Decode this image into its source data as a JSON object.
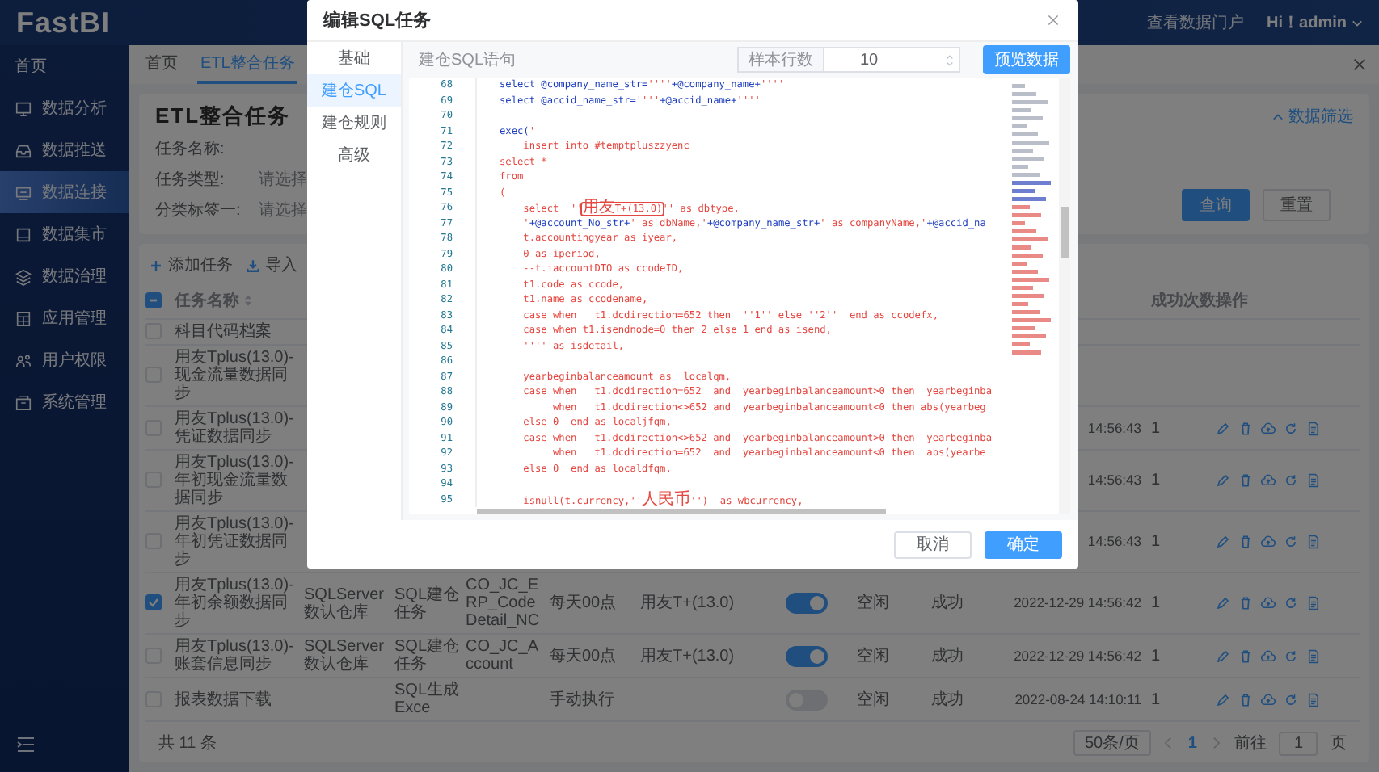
{
  "topbar": {
    "logo": "FastBI",
    "portal_link": "查看数据门户",
    "user": "Hi！admin"
  },
  "sidebar": {
    "items": [
      {
        "label": "首页",
        "selected": false
      },
      {
        "label": "数据分析",
        "selected": false
      },
      {
        "label": "数据推送",
        "selected": false
      },
      {
        "label": "数据连接",
        "selected": true
      },
      {
        "label": "数据集市",
        "selected": false
      },
      {
        "label": "数据治理",
        "selected": false
      },
      {
        "label": "应用管理",
        "selected": false
      },
      {
        "label": "用户权限",
        "selected": false
      },
      {
        "label": "系统管理",
        "selected": false
      }
    ]
  },
  "tabs": [
    {
      "label": "首页",
      "selected": false
    },
    {
      "label": "ETL整合任务",
      "selected": true
    }
  ],
  "filter": {
    "title": "ETL整合任务",
    "toggle": "数据筛选",
    "fields": [
      {
        "label": "任务名称:"
      },
      {
        "label": "任务类型:",
        "placeholder": "请选择"
      },
      {
        "label": "分类标签一:",
        "placeholder": "请选择"
      }
    ],
    "buttons": [
      {
        "label": "查询",
        "kind": "primary"
      },
      {
        "label": "重置",
        "kind": "default"
      }
    ]
  },
  "toolbar": [
    {
      "label": "添加任务",
      "kind": "add"
    },
    {
      "label": "导入",
      "kind": "import"
    }
  ],
  "table": {
    "header": {
      "indeterminate": true,
      "name": "任务名称",
      "count": "成功次数",
      "actions": "操作"
    },
    "rows": [
      {
        "checked": false,
        "name": "科目代码档案"
      },
      {
        "checked": false,
        "name": "用友Tplus(13.0)-现金流量数据同步"
      },
      {
        "checked": false,
        "name": "用友Tplus(13.0)-凭证数据同步",
        "time": "14:56:43",
        "count": "1",
        "actions": true
      },
      {
        "checked": false,
        "name": "用友Tplus(13.0)-年初现金流量数据同步",
        "time": "14:56:43",
        "count": "1",
        "actions": true
      },
      {
        "checked": false,
        "name": "用友Tplus(13.0)-年初凭证数据同步",
        "time": "14:56:43",
        "count": "1",
        "actions": true
      },
      {
        "checked": true,
        "name": "用友Tplus(13.0)-年初余额数据同步",
        "source": "SQLServer数认仓库",
        "type": "SQL建仓任务",
        "table": "CO_JC_ERP_CodeDetail_NC",
        "schedule": "每天00点",
        "datasource": "用友T+(13.0)",
        "on": true,
        "status": "空闲",
        "result": "成功",
        "time": "2022-12-29 14:56:42",
        "count": "1",
        "actions": true
      },
      {
        "checked": false,
        "name": "用友Tplus(13.0)-账套信息同步",
        "source": "SQLServer数认仓库",
        "type": "SQL建仓任务",
        "table": "CO_JC_Account",
        "schedule": "每天00点",
        "datasource": "用友T+(13.0)",
        "on": true,
        "status": "空闲",
        "result": "成功",
        "time": "2022-12-29 14:56:42",
        "count": "1",
        "actions": true
      },
      {
        "checked": false,
        "name": "报表数据下载",
        "type": "SQL生成Exce",
        "schedule": "手动执行",
        "on": false,
        "status": "空闲",
        "result": "成功",
        "time": "2022-08-24 14:10:11",
        "count": "1",
        "actions": true
      }
    ]
  },
  "pagination": {
    "total": "共 11 条",
    "page_size": "50条/页",
    "page": "1",
    "goto_label": "前往",
    "goto_value": "1",
    "goto_unit": "页"
  },
  "modal": {
    "title": "编辑SQL任务",
    "tabs": [
      {
        "label": "基础",
        "selected": false
      },
      {
        "label": "建仓SQL",
        "selected": true
      },
      {
        "label": "建仓规则",
        "selected": false
      },
      {
        "label": "高级",
        "selected": false
      }
    ],
    "editor_label": "建仓SQL语句",
    "sample_label": "样本行数",
    "sample_value": "10",
    "preview_button": "预览数据",
    "lines": [
      {
        "no": "68",
        "parts": [
          {
            "kind": "code",
            "text": "select @company_name_str="
          },
          {
            "kind": "str",
            "text": "''''"
          },
          {
            "kind": "code",
            "text": "+@company_name+"
          },
          {
            "kind": "str",
            "text": "''''"
          }
        ]
      },
      {
        "no": "69",
        "parts": [
          {
            "kind": "code",
            "text": "select @accid_name_str="
          },
          {
            "kind": "str",
            "text": "''''"
          },
          {
            "kind": "code",
            "text": "+@accid_name+"
          },
          {
            "kind": "str",
            "text": "''''"
          }
        ]
      },
      {
        "no": "70"
      },
      {
        "no": "71",
        "parts": [
          {
            "kind": "code",
            "text": "exec("
          },
          {
            "kind": "str",
            "text": "'"
          }
        ]
      },
      {
        "no": "72",
        "parts": [
          {
            "kind": "str",
            "text": "    insert into #temptpluszzyenc"
          }
        ]
      },
      {
        "no": "73",
        "parts": [
          {
            "kind": "str",
            "text": "select *"
          }
        ]
      },
      {
        "no": "74",
        "parts": [
          {
            "kind": "str",
            "text": "from"
          }
        ]
      },
      {
        "no": "75",
        "parts": [
          {
            "kind": "str",
            "text": "("
          }
        ]
      },
      {
        "no": "76",
        "parts": [
          {
            "kind": "str",
            "text": "    select  ''"
          },
          {
            "kind": "match",
            "text": "用友T+(13.0)"
          },
          {
            "kind": "str",
            "text": "'' as dbtype,"
          }
        ]
      },
      {
        "no": "77",
        "parts": [
          {
            "kind": "str",
            "text": "    '"
          },
          {
            "kind": "code",
            "text": "+@account_No_str+"
          },
          {
            "kind": "str",
            "text": "' as dbName,'"
          },
          {
            "kind": "code",
            "text": "+@company_name_str+"
          },
          {
            "kind": "str",
            "text": "' as companyName,'"
          },
          {
            "kind": "code",
            "text": "+@accid_na"
          }
        ]
      },
      {
        "no": "78",
        "parts": [
          {
            "kind": "str",
            "text": "    t.accountingyear as iyear,"
          }
        ]
      },
      {
        "no": "79",
        "parts": [
          {
            "kind": "str",
            "text": "    0 as iperiod,"
          }
        ]
      },
      {
        "no": "80",
        "parts": [
          {
            "kind": "str",
            "text": "    --t.iaccountDTO as ccodeID,"
          }
        ]
      },
      {
        "no": "81",
        "parts": [
          {
            "kind": "str",
            "text": "    t1.code as ccode,"
          }
        ]
      },
      {
        "no": "82",
        "parts": [
          {
            "kind": "str",
            "text": "    t1.name as ccodename,"
          }
        ]
      },
      {
        "no": "83",
        "parts": [
          {
            "kind": "str",
            "text": "    case when   t1.dcdirection=652 then  ''1'' else ''2''  end as ccodefx,"
          }
        ]
      },
      {
        "no": "84",
        "parts": [
          {
            "kind": "str",
            "text": "    case when t1.isendnode=0 then 2 else 1 end as isend,"
          }
        ]
      },
      {
        "no": "85",
        "parts": [
          {
            "kind": "str",
            "text": "    '''' as isdetail,"
          }
        ]
      },
      {
        "no": "86"
      },
      {
        "no": "87",
        "parts": [
          {
            "kind": "str",
            "text": "    yearbeginbalanceamount as  localqm,"
          }
        ]
      },
      {
        "no": "88",
        "parts": [
          {
            "kind": "str",
            "text": "    case when   t1.dcdirection=652  and  yearbeginbalanceamount>0 then  yearbeginba"
          }
        ]
      },
      {
        "no": "89",
        "parts": [
          {
            "kind": "str",
            "text": "         when   t1.dcdirection<>652 and  yearbeginbalanceamount<0 then abs(yearbeg"
          }
        ]
      },
      {
        "no": "90",
        "parts": [
          {
            "kind": "str",
            "text": "    else 0  end as localjfqm,"
          }
        ]
      },
      {
        "no": "91",
        "parts": [
          {
            "kind": "str",
            "text": "    case when   t1.dcdirection<>652 and  yearbeginbalanceamount>0 then  yearbeginba"
          }
        ]
      },
      {
        "no": "92",
        "parts": [
          {
            "kind": "str",
            "text": "         when   t1.dcdirection=652  and  yearbeginbalanceamount<0 then  abs(yearbe"
          }
        ]
      },
      {
        "no": "93",
        "parts": [
          {
            "kind": "str",
            "text": "    else 0  end as localdfqm,"
          }
        ]
      },
      {
        "no": "94"
      },
      {
        "no": "95",
        "parts": [
          {
            "kind": "str",
            "text": "    isnull(t.currency,''人民币'')  as wbcurrency,"
          }
        ]
      }
    ],
    "buttons": [
      {
        "label": "取消",
        "kind": "default"
      },
      {
        "label": "确定",
        "kind": "primary"
      }
    ]
  }
}
